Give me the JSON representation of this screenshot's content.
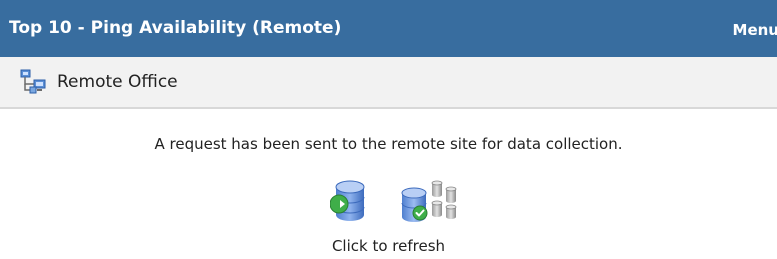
{
  "widget": {
    "title": "Top 10 - Ping Availability (Remote)",
    "menu_label": "Menu"
  },
  "subheader": {
    "icon": "network-nodes-icon",
    "label": "Remote Office"
  },
  "body": {
    "message": "A request has been sent to the remote site for data collection.",
    "icons": [
      "database-send-icon",
      "database-cluster-check-icon"
    ],
    "refresh_label": "Click to refresh"
  },
  "colors": {
    "header_bg": "#386d9f",
    "subheader_bg": "#f2f2f2",
    "accent_green": "#39a845"
  }
}
